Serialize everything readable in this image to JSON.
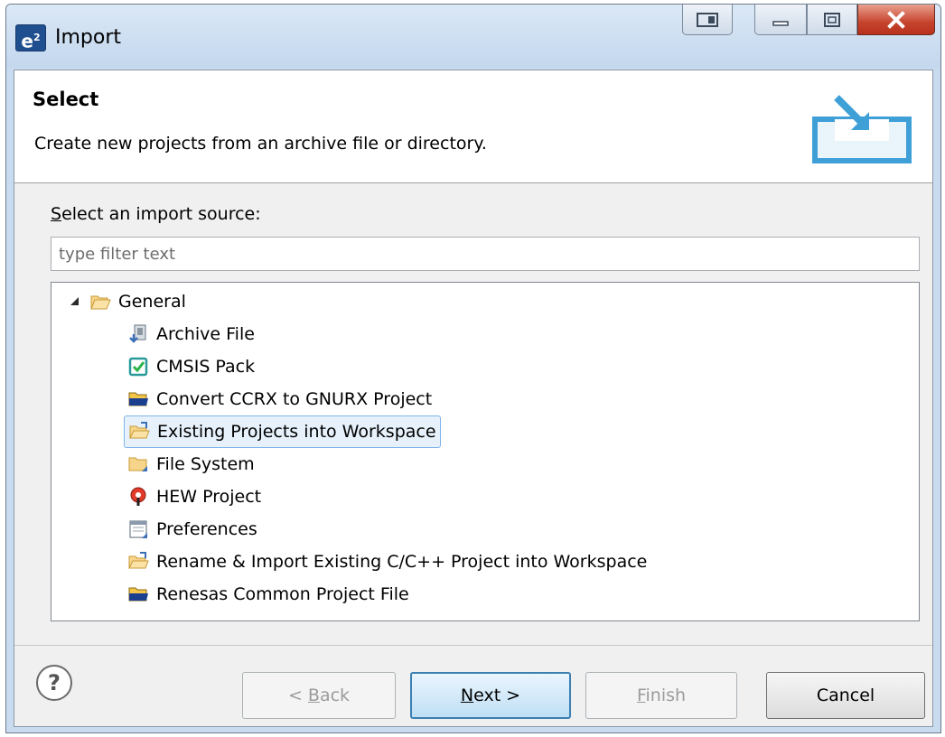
{
  "window": {
    "title": "Import",
    "app_icon_text": "e"
  },
  "banner": {
    "title": "Select",
    "description": "Create new projects from an archive file or directory."
  },
  "import_source": {
    "label_prefix": "S",
    "label_rest": "elect an import source:",
    "filter_placeholder": "type filter text"
  },
  "tree": {
    "root": {
      "label": "General",
      "icon": "folder-open-icon",
      "expanded": true
    },
    "items": [
      {
        "label": "Archive File",
        "icon": "archive-file-icon"
      },
      {
        "label": "CMSIS Pack",
        "icon": "cmsis-pack-icon"
      },
      {
        "label": "Convert CCRX to GNURX Project",
        "icon": "renesas-folder-icon"
      },
      {
        "label": "Existing Projects into Workspace",
        "icon": "existing-projects-icon",
        "selected": true
      },
      {
        "label": "File System",
        "icon": "file-system-folder-icon"
      },
      {
        "label": "HEW Project",
        "icon": "hew-project-icon"
      },
      {
        "label": "Preferences",
        "icon": "preferences-icon"
      },
      {
        "label": "Rename & Import Existing C/C++ Project into Workspace",
        "icon": "rename-import-icon"
      },
      {
        "label": "Renesas Common Project File",
        "icon": "renesas-folder-icon"
      }
    ]
  },
  "buttons": {
    "help": "?",
    "back_prefix": "< ",
    "back_mnemonic": "B",
    "back_rest": "ack",
    "next_mnemonic": "N",
    "next_rest": "ext >",
    "finish_mnemonic": "F",
    "finish_rest": "inish",
    "cancel": "Cancel"
  },
  "colors": {
    "selection_bg": "#e6f1fb",
    "selection_border": "#7eb4ea",
    "close_button": "#c6442e",
    "default_button_border": "#3c7fb1"
  }
}
